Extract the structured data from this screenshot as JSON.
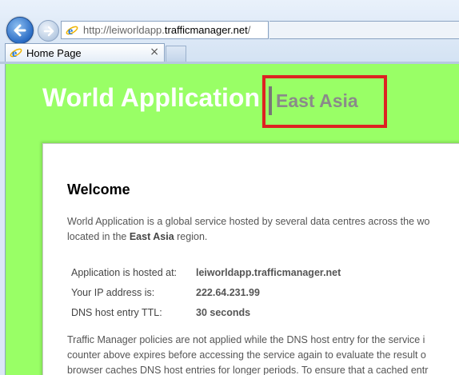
{
  "browser": {
    "url_prefix": "http://leiworldapp.",
    "url_host": "trafficmanager.net",
    "url_suffix": "/",
    "tab_title": "Home Page",
    "tab_close": "×",
    "icons": {
      "back": "back-arrow-icon",
      "forward": "forward-arrow-icon",
      "page": "ie-logo-icon"
    }
  },
  "header": {
    "title": "World Application",
    "region": "East Asia",
    "highlight_color": "#dd2222",
    "background_color": "#99ff66"
  },
  "main": {
    "heading": "Welcome",
    "intro_line1": "World Application is a global service hosted by several data centres across the wo",
    "intro_line2_before": "located in the ",
    "intro_region": "East Asia",
    "intro_line2_after": " region.",
    "info": [
      {
        "label": "Application is hosted at:",
        "value": "leiworldapp.trafficmanager.net"
      },
      {
        "label": "Your IP address is:",
        "value": "222.64.231.99"
      },
      {
        "label": "DNS host entry TTL:",
        "value": "30 seconds"
      }
    ],
    "para_lines": [
      "Traffic Manager policies are not applied while the DNS host entry for the service i",
      "counter above expires before accessing the service again to evaluate the result o",
      "browser caches DNS host entries for longer periods. To ensure that a cached entr"
    ]
  }
}
